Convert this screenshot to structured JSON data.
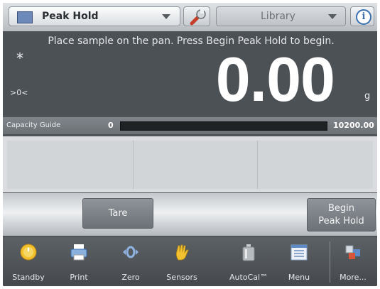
{
  "header": {
    "app_name": "Peak Hold",
    "library_label": "Library"
  },
  "display": {
    "instruction": "Place sample on the pan.  Press Begin Peak Hold to begin.",
    "stability_indicator": "*",
    "center_of_zero": ">0<",
    "weight": "0.00",
    "unit": "g"
  },
  "capacity_guide": {
    "label": "Capacity Guide",
    "min": "0",
    "max": "10200.00",
    "fill_fraction": 0.0
  },
  "actions": {
    "tare": "Tare",
    "begin_line1": "Begin",
    "begin_line2": "Peak Hold"
  },
  "nav": {
    "items": [
      {
        "label": "Standby",
        "icon": "standby-icon"
      },
      {
        "label": "Print",
        "icon": "printer-icon"
      },
      {
        "label": "Zero",
        "icon": "zero-icon"
      },
      {
        "label": "Sensors",
        "icon": "hand-sensor-icon"
      },
      {
        "label": "AutoCal™",
        "icon": "calibration-weight-icon"
      },
      {
        "label": "Menu",
        "icon": "menu-icon"
      },
      {
        "label": "More...",
        "icon": "more-icon"
      }
    ]
  },
  "colors": {
    "accent_blue": "#3b6faf",
    "display_bg": "#4c5156",
    "standby_yellow": "#f3c12c"
  }
}
